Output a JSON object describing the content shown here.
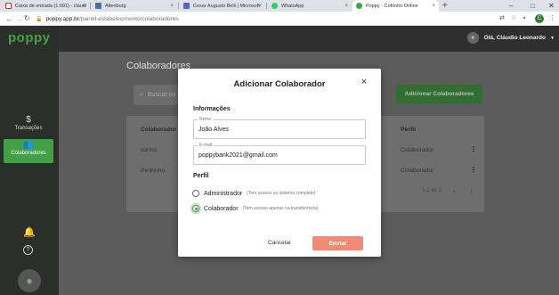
{
  "browser": {
    "tabs": [
      {
        "title": "Caixa de entrada (1.091) - claudi",
        "color": "#d93025"
      },
      {
        "title": "Altenburg",
        "color": "#4a6fa5"
      },
      {
        "title": "Cesar Augusto Belli | Microsoft",
        "color": "#5b5fc7"
      },
      {
        "title": "WhatsApp",
        "color": "#25d366"
      },
      {
        "title": "Poppy - Cofrinho Online",
        "color": "#43a047"
      }
    ],
    "new_tab": "+",
    "url_host": "poppy.app.br",
    "url_path": "/painel-estabelecimento/colaboradores",
    "profile_initial": "C",
    "tab_close": "×",
    "window_controls": {
      "minimize": "–",
      "maximize": "□",
      "close": "✕"
    },
    "nav": {
      "back": "←",
      "forward": "→",
      "reload": "↻"
    }
  },
  "app": {
    "logo": "poppy",
    "sidebar": {
      "items": [
        {
          "label": "Transações",
          "icon": "dollar-icon",
          "glyph": "$"
        },
        {
          "label": "Colaboradores",
          "icon": "people-icon",
          "glyph": "👥"
        }
      ],
      "bell_glyph": "🔔",
      "help_glyph": "?"
    },
    "user": {
      "greeting": "Olá, Cláudio Leonardo",
      "chevron": "▾"
    },
    "page": {
      "title": "Colaboradores",
      "search_placeholder": "Buscar co",
      "add_button": "Adicionar Colaboradores",
      "table": {
        "headers": [
          "Colaborador",
          "Perfil"
        ],
        "rows": [
          {
            "name": "carlos",
            "profile": "Colaborador"
          },
          {
            "name": "Pedrinho",
            "profile": "Colaborador"
          }
        ],
        "pagination": "1-2 de 2"
      }
    }
  },
  "modal": {
    "title": "Adicionar Colaborador",
    "close": "×",
    "info_section": "Informações",
    "name_label": "Nome",
    "name_value": "João Alves",
    "email_label": "E-mail",
    "email_value": "poppybank2021@gmail.com",
    "profile_section": "Perfil",
    "options": [
      {
        "label": "Administrador",
        "hint": "(Tem acesso ao sistema completo)",
        "checked": false
      },
      {
        "label": "Colaborador",
        "hint": "(Tem acesso apenas na transferência)",
        "checked": true
      }
    ],
    "cancel": "Cancelar",
    "submit": "Enviar"
  },
  "colors": {
    "brand_green": "#43a047",
    "submit_salmon": "#f28b73"
  }
}
